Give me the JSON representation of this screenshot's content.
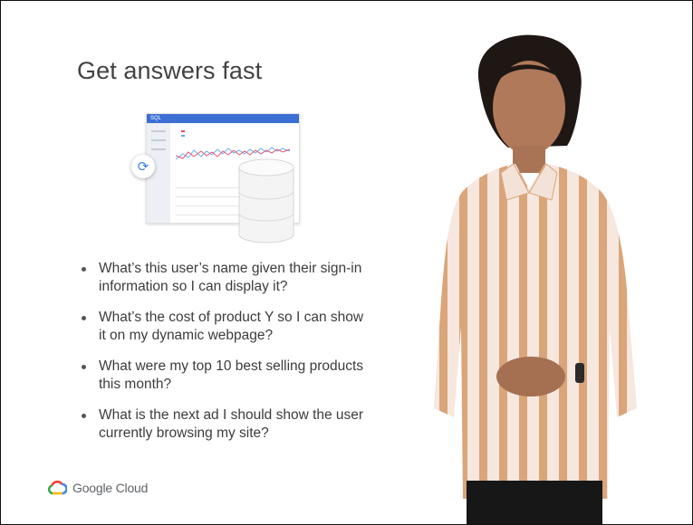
{
  "slide": {
    "title": "Get answers fast",
    "bullets": [
      "What’s this user’s name given their sign-in information so I can display it?",
      "What’s the cost of product Y so I can show it on my dynamic webpage?",
      "What were my top 10 best selling products this month?",
      "What is the next ad I should show the user currently browsing my site?"
    ]
  },
  "illustration": {
    "window_title": "SQL",
    "icons": [
      "refresh-icon",
      "database-icon"
    ]
  },
  "branding": {
    "logo_text": "Google Cloud",
    "colors": {
      "red": "#ea4335",
      "blue": "#4285f4",
      "yellow": "#fbbc04",
      "green": "#34a853"
    }
  }
}
